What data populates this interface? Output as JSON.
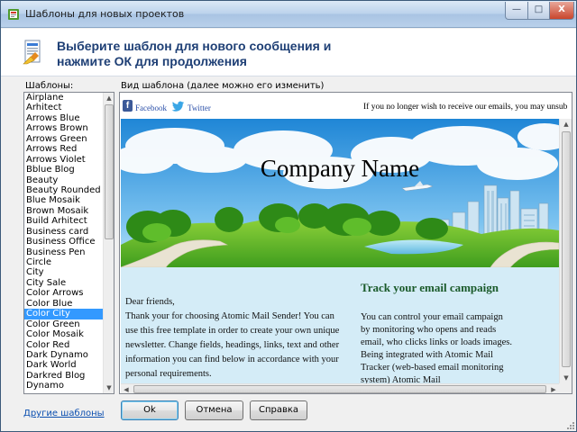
{
  "window": {
    "title": "Шаблоны для новых проектов"
  },
  "header": {
    "heading": "Выберите шаблон для нового сообщения и нажмите ОК для продолжения"
  },
  "templates": {
    "label": "Шаблоны:",
    "items": [
      "Airplane",
      "Arhitect",
      "Arrows Blue",
      "Arrows Brown",
      "Arrows Green",
      "Arrows Red",
      "Arrows Violet",
      "Bblue Blog",
      "Beauty",
      "Beauty Rounded",
      "Blue Mosaik",
      "Brown Mosaik",
      "Build Arhitect",
      "Business card",
      "Business Office",
      "Business Pen",
      "Circle",
      "City",
      "City Sale",
      "Color Arrows",
      "Color Blue",
      "Color City",
      "Color Green",
      "Color Mosaik",
      "Color Red",
      "Dark Dynamo",
      "Dark World",
      "Darkred Blog",
      "Dynamo"
    ],
    "selected": "Color City"
  },
  "preview": {
    "label": "Вид шаблона (далее можно его изменить)",
    "facebook": "Facebook",
    "twitter": "Twitter",
    "unsubscribe": "If you no longer wish to receive our emails, you may unsub",
    "company": "Company Name",
    "greeting": "Dear friends,",
    "intro": "Thank your for choosing Atomic Mail Sender! You can use this free template in order to create your own unique newsletter. Change fields, headings, links, text and other information you can find below in accordance with your personal requirements.",
    "track_title": "Track your email campaign",
    "track_text": "You can control your email campaign by monitoring who opens and reads email, who clicks links or loads images. Being integrated with Atomic Mail Tracker (web-based email monitoring system) Atomic Mail"
  },
  "footer": {
    "more_link": "Другие шаблоны",
    "ok": "Ok",
    "cancel": "Отмена",
    "help": "Справка"
  },
  "window_buttons": {
    "minimize": "—",
    "maximize": "□",
    "close": "X"
  }
}
